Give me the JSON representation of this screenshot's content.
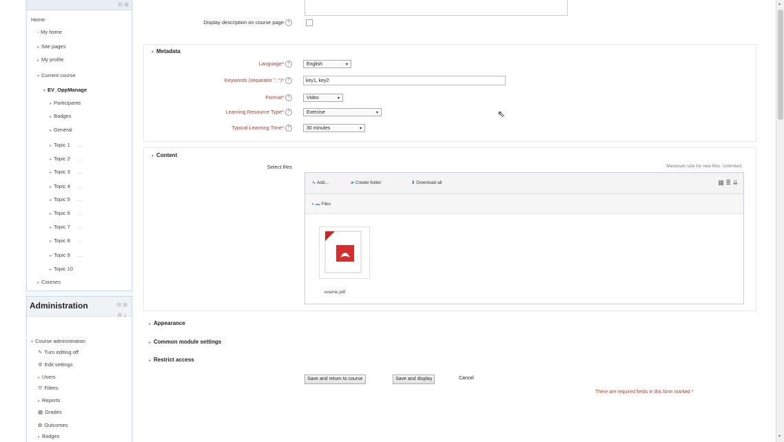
{
  "nav": {
    "items": [
      {
        "label": "Home",
        "level": 0,
        "arrow": ""
      },
      {
        "label": "My home",
        "level": 1,
        "arrow": "•"
      },
      {
        "label": "Site pages",
        "level": 1,
        "arrow": "▸"
      },
      {
        "label": "My profile",
        "level": 1,
        "arrow": "▸"
      },
      {
        "label": "Current course",
        "level": 1,
        "arrow": "▾"
      },
      {
        "label": "EV_OppManage",
        "level": 2,
        "arrow": "▾",
        "bold": true
      },
      {
        "label": "Participants",
        "level": 3,
        "arrow": "▸"
      },
      {
        "label": "Badges",
        "level": 3,
        "arrow": "▸"
      },
      {
        "label": "General",
        "level": 3,
        "arrow": "▸"
      },
      {
        "label": "Topic 1",
        "level": 3,
        "arrow": "▸",
        "dots": "...."
      },
      {
        "label": "Topic 2",
        "level": 3,
        "arrow": "▸",
        "dots": "...."
      },
      {
        "label": "Topic 3",
        "level": 3,
        "arrow": "▸",
        "dots": "...."
      },
      {
        "label": "Topic 4",
        "level": 3,
        "arrow": "▸",
        "dots": "...."
      },
      {
        "label": "Topic 5",
        "level": 3,
        "arrow": "▸",
        "dots": "...."
      },
      {
        "label": "Topic 6",
        "level": 3,
        "arrow": "▸",
        "dots": "...."
      },
      {
        "label": "Topic 7",
        "level": 3,
        "arrow": "▸",
        "dots": "...."
      },
      {
        "label": "Topic 8",
        "level": 3,
        "arrow": "▸",
        "dots": "...."
      },
      {
        "label": "Topic 9",
        "level": 3,
        "arrow": "▸",
        "dots": "...."
      },
      {
        "label": "Topic 10",
        "level": 3,
        "arrow": "▸"
      },
      {
        "label": "Courses",
        "level": 1,
        "arrow": "▸"
      }
    ]
  },
  "admin": {
    "title": "Administration",
    "items": [
      {
        "label": "Course administration",
        "arrow": "▾",
        "icon": ""
      },
      {
        "label": "Turn editing off",
        "arrow": "",
        "icon": "pencil-icon"
      },
      {
        "label": "Edit settings",
        "arrow": "",
        "icon": "gear-icon"
      },
      {
        "label": "Users",
        "arrow": "▸",
        "icon": ""
      },
      {
        "label": "Filters",
        "arrow": "",
        "icon": "filter-icon"
      },
      {
        "label": "Reports",
        "arrow": "▸",
        "icon": ""
      },
      {
        "label": "Grades",
        "arrow": "",
        "icon": "grades-icon"
      },
      {
        "label": "Outcomes",
        "arrow": "",
        "icon": "outcomes-icon"
      },
      {
        "label": "Badges",
        "arrow": "▸",
        "icon": ""
      }
    ]
  },
  "description": {
    "label": "Display description on course page"
  },
  "metadata": {
    "legend": "Metadata",
    "language_label": "Language*",
    "language_value": "English",
    "keywords_label": "Keywords (separator \", \")*",
    "keywords_value": "key1, key2",
    "format_label": "Format*",
    "format_value": "Video",
    "lrt_label": "Learning Resource Type*",
    "lrt_value": "Exercise",
    "tlt_label": "Typical Learning Time*",
    "tlt_value": "30 minutes"
  },
  "content": {
    "legend": "Content",
    "select_files_label": "Select files",
    "max_size": "Maximum size for new files: Unlimited",
    "add_label": "Add...",
    "create_folder_label": "Create folder",
    "download_all_label": "Download all",
    "path_label": "Files",
    "file_name": "exame.pdf"
  },
  "sections": {
    "appearance": "Appearance",
    "common_module": "Common module settings",
    "restrict_access": "Restrict access"
  },
  "buttons": {
    "save_return": "Save and return to course",
    "save_display": "Save and display",
    "cancel": "Cancel"
  },
  "required_note": "There are required fields in this form marked",
  "colors": {
    "required": "#c0392b",
    "accent": "#1a66a8"
  }
}
